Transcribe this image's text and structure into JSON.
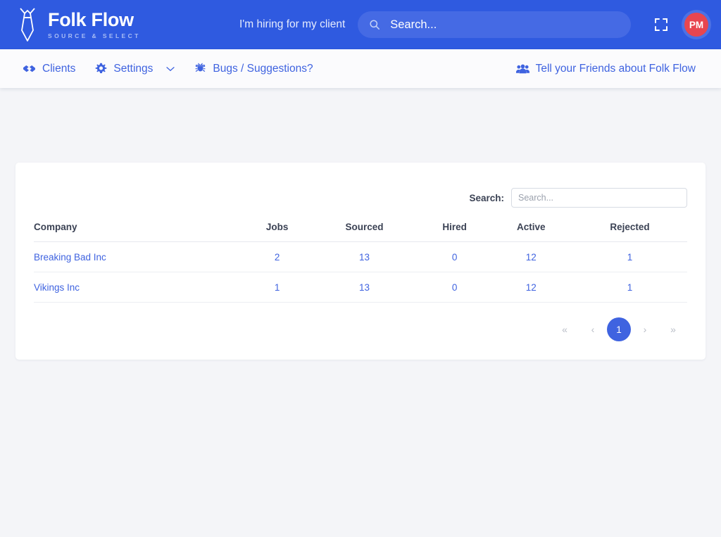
{
  "header": {
    "brand_name": "Folk Flow",
    "brand_tagline": "SOURCE & SELECT",
    "tie_icon": "tie-icon",
    "hiring_text": "I'm hiring for my client",
    "search_placeholder": "Search...",
    "search_value": "",
    "search_icon": "search-icon",
    "expand_icon": "fullscreen-expand-icon",
    "avatar_initials": "PM",
    "colors": {
      "header_bg": "#2f5ae0",
      "search_pill": "#456ae4",
      "avatar_bg": "#e8464f",
      "link_blue": "#3f63e0"
    }
  },
  "nav": {
    "items": [
      {
        "label": "Clients",
        "icon": "handshake-icon",
        "has_caret": false
      },
      {
        "label": "Settings",
        "icon": "gear-icon",
        "has_caret": true
      },
      {
        "label": "Bugs / Suggestions?",
        "icon": "bug-icon",
        "has_caret": false
      }
    ],
    "right": {
      "label": "Tell your Friends about Folk Flow",
      "icon": "users-group-icon"
    }
  },
  "table_panel": {
    "search_label": "Search:",
    "search_placeholder": "Search...",
    "search_value": "",
    "columns": [
      "Company",
      "Jobs",
      "Sourced",
      "Hired",
      "Active",
      "Rejected"
    ],
    "rows": [
      {
        "company": "Breaking Bad Inc",
        "jobs": "2",
        "sourced": "13",
        "hired": "0",
        "active": "12",
        "rejected": "1"
      },
      {
        "company": "Vikings Inc",
        "jobs": "1",
        "sourced": "13",
        "hired": "0",
        "active": "12",
        "rejected": "1"
      }
    ],
    "pagination": {
      "first": "«",
      "prev": "‹",
      "pages": [
        "1"
      ],
      "current": "1",
      "next": "›",
      "last": "»"
    }
  }
}
